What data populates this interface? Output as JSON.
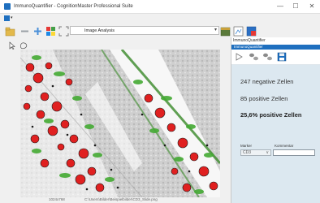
{
  "window": {
    "title": "ImmunoQuantifier - CognitionMaster Professional Suite",
    "minimize_glyph": "—",
    "maximize_glyph": "☐",
    "close_glyph": "✕"
  },
  "toolbar": {
    "combo_value": "Image Analysis"
  },
  "panel": {
    "title": "ImmunoQuantifier",
    "header": "ImmunoQuantifier",
    "negative_cells": "247 negative Zellen",
    "positive_cells": "85 positive Zellen",
    "positive_percent": "25,6% positive Zellen",
    "marker_label": "Marker",
    "marker_value": "CD3",
    "comment_label": "Kommentar",
    "comment_value": ""
  },
  "status": {
    "left": "1024x768",
    "right": "C:\\Users\\Bilder\\Beispielbilder\\CD3_Slide.png"
  },
  "colors": {
    "accent": "#1e6fbf",
    "panel_bg": "#dce8f0",
    "positive_cell": "#e02020",
    "negative_cell": "#44aa33"
  }
}
